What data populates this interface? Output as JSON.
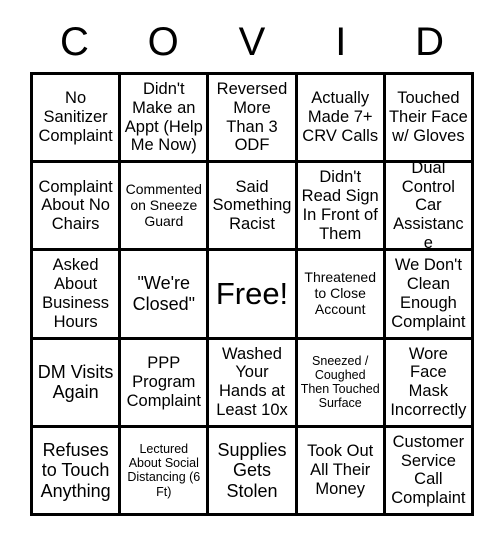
{
  "card": {
    "title_letters": [
      "C",
      "O",
      "V",
      "I",
      "D"
    ],
    "grid_size": "5x5",
    "free_space_index": 12,
    "colors": {
      "background": "#ffffff",
      "border": "#000000",
      "text": "#000000"
    }
  },
  "cells": [
    {
      "text": "No Sanitizer Complaint",
      "size": "sz-md"
    },
    {
      "text": "Didn't Make an Appt (Help Me Now)",
      "size": "sz-md"
    },
    {
      "text": "Reversed More Than 3 ODF",
      "size": "sz-md"
    },
    {
      "text": "Actually Made 7+ CRV Calls",
      "size": "sz-md"
    },
    {
      "text": "Touched Their Face w/ Gloves",
      "size": "sz-md"
    },
    {
      "text": "Complaint About No Chairs",
      "size": "sz-md"
    },
    {
      "text": "Commented on Sneeze Guard",
      "size": "sz-sm"
    },
    {
      "text": "Said Something Racist",
      "size": "sz-md"
    },
    {
      "text": "Didn't Read Sign In Front of Them",
      "size": "sz-md"
    },
    {
      "text": "Dual Control Car Assistance",
      "size": "sz-md"
    },
    {
      "text": "Asked About Business Hours",
      "size": "sz-md"
    },
    {
      "text": "\"We're Closed\"",
      "size": "sz-lg"
    },
    {
      "text": "Free!",
      "size": "sz-xl"
    },
    {
      "text": "Threatened to Close Account",
      "size": "sz-sm"
    },
    {
      "text": "We Don't Clean Enough Complaint",
      "size": "sz-md"
    },
    {
      "text": "DM Visits Again",
      "size": "sz-lg"
    },
    {
      "text": "PPP Program Complaint",
      "size": "sz-md"
    },
    {
      "text": "Washed Your Hands at Least 10x",
      "size": "sz-md"
    },
    {
      "text": "Sneezed / Coughed Then Touched Surface",
      "size": "sz-xs"
    },
    {
      "text": "Wore Face Mask Incorrectly",
      "size": "sz-md"
    },
    {
      "text": "Refuses to Touch Anything",
      "size": "sz-lg"
    },
    {
      "text": "Lectured About Social Distancing (6 Ft)",
      "size": "sz-xs"
    },
    {
      "text": "Supplies Gets Stolen",
      "size": "sz-lg"
    },
    {
      "text": "Took Out All Their Money",
      "size": "sz-md"
    },
    {
      "text": "Customer Service Call Complaint",
      "size": "sz-md"
    }
  ]
}
